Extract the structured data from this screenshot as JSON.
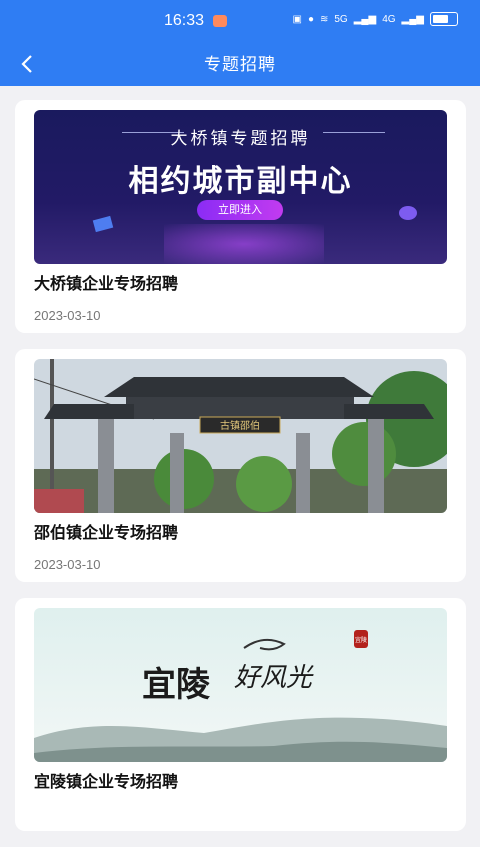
{
  "status_bar": {
    "time": "16:33",
    "network": "5G",
    "network2": "4G",
    "battery_level": 0.75
  },
  "header": {
    "title": "专题招聘"
  },
  "items": [
    {
      "title": "大桥镇企业专场招聘",
      "date": "2023-03-10",
      "banner": {
        "heading": "大桥镇专题招聘",
        "slogan": "相约城市副中心",
        "button": "立即进入"
      }
    },
    {
      "title": "邵伯镇企业专场招聘",
      "date": "2023-03-10",
      "banner": {
        "plaque": "古镇邵伯"
      }
    },
    {
      "title": "宜陵镇企业专场招聘",
      "date": "",
      "banner": {
        "calligraphy_a": "宜陵",
        "calligraphy_b": "好风光",
        "seal": "宜陵"
      }
    }
  ]
}
